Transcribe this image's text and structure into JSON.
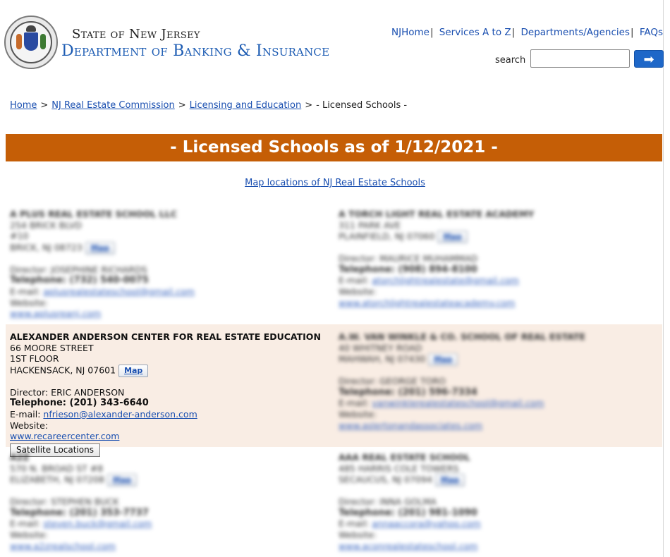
{
  "header": {
    "state_title": "State of New Jersey",
    "dept_title": "Department of Banking & Insurance",
    "seal_icon": "nj-state-seal-icon"
  },
  "topnav": {
    "items": [
      "NJHome",
      "Services A to Z",
      "Departments/Agencies",
      "FAQs"
    ],
    "separator": "|"
  },
  "search": {
    "label": "search",
    "value": "",
    "placeholder": "",
    "button_icon": "arrow-right-icon",
    "button_glyph": "➡"
  },
  "breadcrumb": {
    "items": [
      "Home",
      "NJ Real Estate Commission",
      "Licensing and Education"
    ],
    "current": "- Licensed Schools -",
    "separator": ">"
  },
  "banner": {
    "title": "- Licensed Schools as of 1/12/2021 -"
  },
  "map_link": {
    "label": "Map locations of NJ Real Estate Schools"
  },
  "colors": {
    "banner_bg": "#c55e06",
    "highlight_bg": "#f9ede4",
    "link": "#1a4fb0",
    "search_button": "#1e67c8"
  },
  "schools": {
    "s1": {
      "name": "A PLUS REAL ESTATE SCHOOL LLC",
      "addr1": "254 BRICK BLVD",
      "addr2": "#10",
      "city": "BRICK, NJ 08723",
      "map": "Map",
      "director": "Director: JOSEPHINE RICHARDS",
      "phone": "Telephone: (732) 540-0075",
      "email_label": "E-mail:",
      "email": "aplusrealestateschool@gmail.com",
      "website_label": "Website:",
      "website": "www.aplusreanj.com"
    },
    "s2": {
      "name": "A TORCH LIGHT REAL ESTATE ACADEMY",
      "addr1": "311 PARK AVE",
      "city": "PLAINFIELD, NJ 07060",
      "map": "Map",
      "director": "Director: MAURICE MUHAMMAD",
      "phone": "Telephone: (908) 894-8100",
      "email_label": "E-mail:",
      "email": "atorchlightrealestate@gmail.com",
      "website_label": "Website:",
      "website": "www.atorchlightrealestateacademy.com"
    },
    "s3": {
      "name": "ALEXANDER ANDERSON CENTER FOR REAL ESTATE EDUCATION",
      "addr1": "66 MOORE STREET",
      "addr2": "1ST FLOOR",
      "city": "HACKENSACK, NJ 07601",
      "map": "Map",
      "director": "Director: ERIC ANDERSON",
      "phone": "Telephone: (201) 343-6640",
      "email_label": "E-mail:",
      "email": "nfrieson@alexander-anderson.com",
      "website_label": "Website:",
      "website": "www.recareercenter.com",
      "satellite": "Satellite Locations"
    },
    "s4": {
      "name": "A.W. VAN WINKLE & CO. SCHOOL OF REAL ESTATE",
      "addr1": "40 WHITNEY ROAD",
      "city": "MAHWAH, NJ 07430",
      "map": "Map",
      "director": "Director: GEORGE TORO",
      "phone": "Telephone: (201) 596-7334",
      "email_label": "E-mail:",
      "email": "vanwinklerealestateschool@gmail.com",
      "website_label": "Website:",
      "website": "www.aslertonandassociates.com"
    },
    "s5": {
      "name": "A2Z",
      "addr1": "570 N. BROAD ST #8",
      "city": "ELIZABETH, NJ 07208",
      "map": "Map",
      "director": "Director: STEPHEN BUCK",
      "phone": "Telephone: (201) 353-7737",
      "email_label": "E-mail:",
      "email": "steven.buck@gmail.com",
      "website_label": "Website:",
      "website": "www.a2zrealschool.com"
    },
    "s6": {
      "name": "AAA REAL ESTATE SCHOOL",
      "addr1": "485 HARRIS COLE TOWERS",
      "city": "SECAUCUS, NJ 07094",
      "map": "Map",
      "director": "Director: INNA GOLMA",
      "phone": "Telephone: (201) 981-1090",
      "email_label": "E-mail:",
      "email": "annaaccora@yahoo.com",
      "website_label": "Website:",
      "website": "www.aconrealestateschool.com"
    }
  }
}
